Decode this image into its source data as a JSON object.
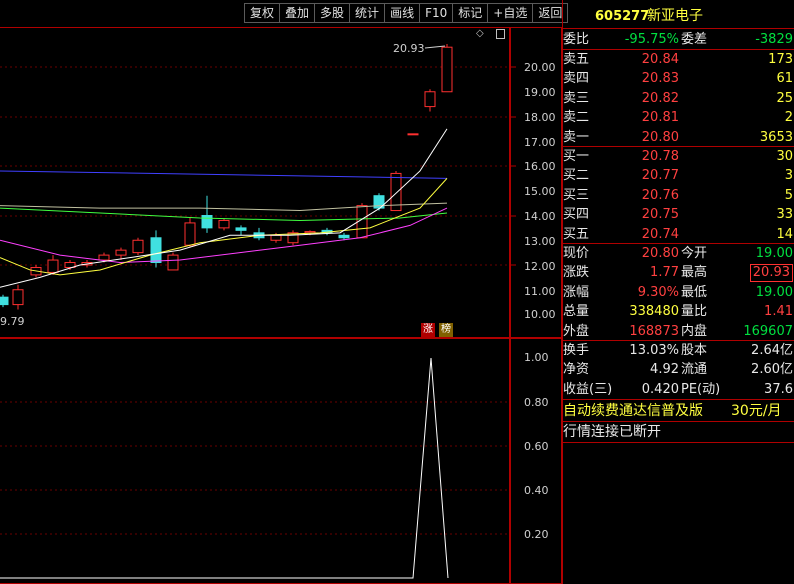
{
  "toolbar": [
    "复权",
    "叠加",
    "多股",
    "统计",
    "画线",
    "F10",
    "标记",
    "+自选",
    "返回"
  ],
  "chart": {
    "high_marker": "20.93",
    "low_marker": "9.79",
    "price_axis": [
      "20.00",
      "19.00",
      "18.00",
      "17.00",
      "16.00",
      "15.00",
      "14.00",
      "13.00",
      "12.00",
      "11.00",
      "10.00"
    ],
    "indicator_axis": [
      "1.00",
      "0.80",
      "0.60",
      "0.40",
      "0.20"
    ],
    "tags": [
      "涨",
      "榜"
    ],
    "colors": {
      "up": "#ff3030",
      "down": "#40e0e0",
      "ma1": "#ffffff",
      "ma2": "#ffff40",
      "ma3": "#ff40ff",
      "ma4": "#40ff40",
      "ma5": "#4040ff"
    }
  },
  "stock": {
    "code": "605277",
    "name": "新亚电子"
  },
  "weibi": {
    "label": "委比",
    "value": "-95.75%",
    "diff_label": "委差",
    "diff_value": "-3829"
  },
  "asks": [
    {
      "label": "卖五",
      "price": "20.84",
      "vol": "173"
    },
    {
      "label": "卖四",
      "price": "20.83",
      "vol": "61"
    },
    {
      "label": "卖三",
      "price": "20.82",
      "vol": "25"
    },
    {
      "label": "卖二",
      "price": "20.81",
      "vol": "2"
    },
    {
      "label": "卖一",
      "price": "20.80",
      "vol": "3653"
    }
  ],
  "bids": [
    {
      "label": "买一",
      "price": "20.78",
      "vol": "30"
    },
    {
      "label": "买二",
      "price": "20.77",
      "vol": "3"
    },
    {
      "label": "买三",
      "price": "20.76",
      "vol": "5"
    },
    {
      "label": "买四",
      "price": "20.75",
      "vol": "33"
    },
    {
      "label": "买五",
      "price": "20.74",
      "vol": "14"
    }
  ],
  "quote": [
    {
      "l1": "现价",
      "v1": "20.80",
      "c1": "red",
      "l2": "今开",
      "v2": "19.00",
      "c2": "green"
    },
    {
      "l1": "涨跌",
      "v1": "1.77",
      "c1": "red",
      "l2": "最高",
      "v2": "20.93",
      "c2": "red"
    },
    {
      "l1": "涨幅",
      "v1": "9.30%",
      "c1": "red",
      "l2": "最低",
      "v2": "19.00",
      "c2": "green"
    },
    {
      "l1": "总量",
      "v1": "338480",
      "c1": "yellow",
      "l2": "量比",
      "v2": "1.41",
      "c2": "red"
    },
    {
      "l1": "外盘",
      "v1": "168873",
      "c1": "red",
      "l2": "内盘",
      "v2": "169607",
      "c2": "green"
    }
  ],
  "fundamentals": [
    {
      "l1": "换手",
      "v1": "13.03%",
      "l2": "股本",
      "v2": "2.64亿"
    },
    {
      "l1": "净资",
      "v1": "4.92",
      "l2": "流通",
      "v2": "2.60亿"
    },
    {
      "l1": "收益(三)",
      "v1": "0.420",
      "l2": "PE(动)",
      "v2": "37.6"
    }
  ],
  "promo": {
    "text": "自动续费通达信普及版",
    "price": "30元/月"
  },
  "status": "行情连接已断开"
}
